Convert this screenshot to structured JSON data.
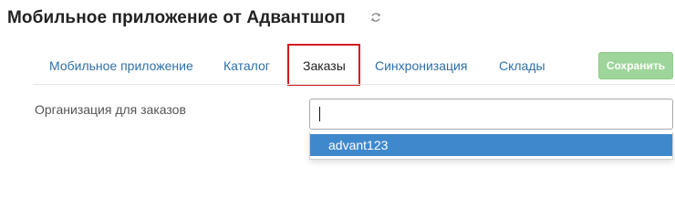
{
  "header": {
    "title": "Мобильное приложение от Адвантшоп",
    "refresh_icon": "refresh-icon"
  },
  "tabs": [
    {
      "label": "Мобильное приложение",
      "active": false
    },
    {
      "label": "Каталог",
      "active": false
    },
    {
      "label": "Заказы",
      "active": true
    },
    {
      "label": "Синхронизация",
      "active": false
    },
    {
      "label": "Склады",
      "active": false
    }
  ],
  "toolbar": {
    "save_label": "Сохранить"
  },
  "form": {
    "organization_label": "Организация для заказов",
    "organization_input_value": "",
    "dropdown_options": [
      {
        "label": "advant123",
        "highlighted": true
      }
    ]
  },
  "colors": {
    "link": "#2f6fa8",
    "active_highlight": "#d7191f",
    "save_button": "#9ed59a",
    "dropdown_selected": "#3f88cc"
  }
}
